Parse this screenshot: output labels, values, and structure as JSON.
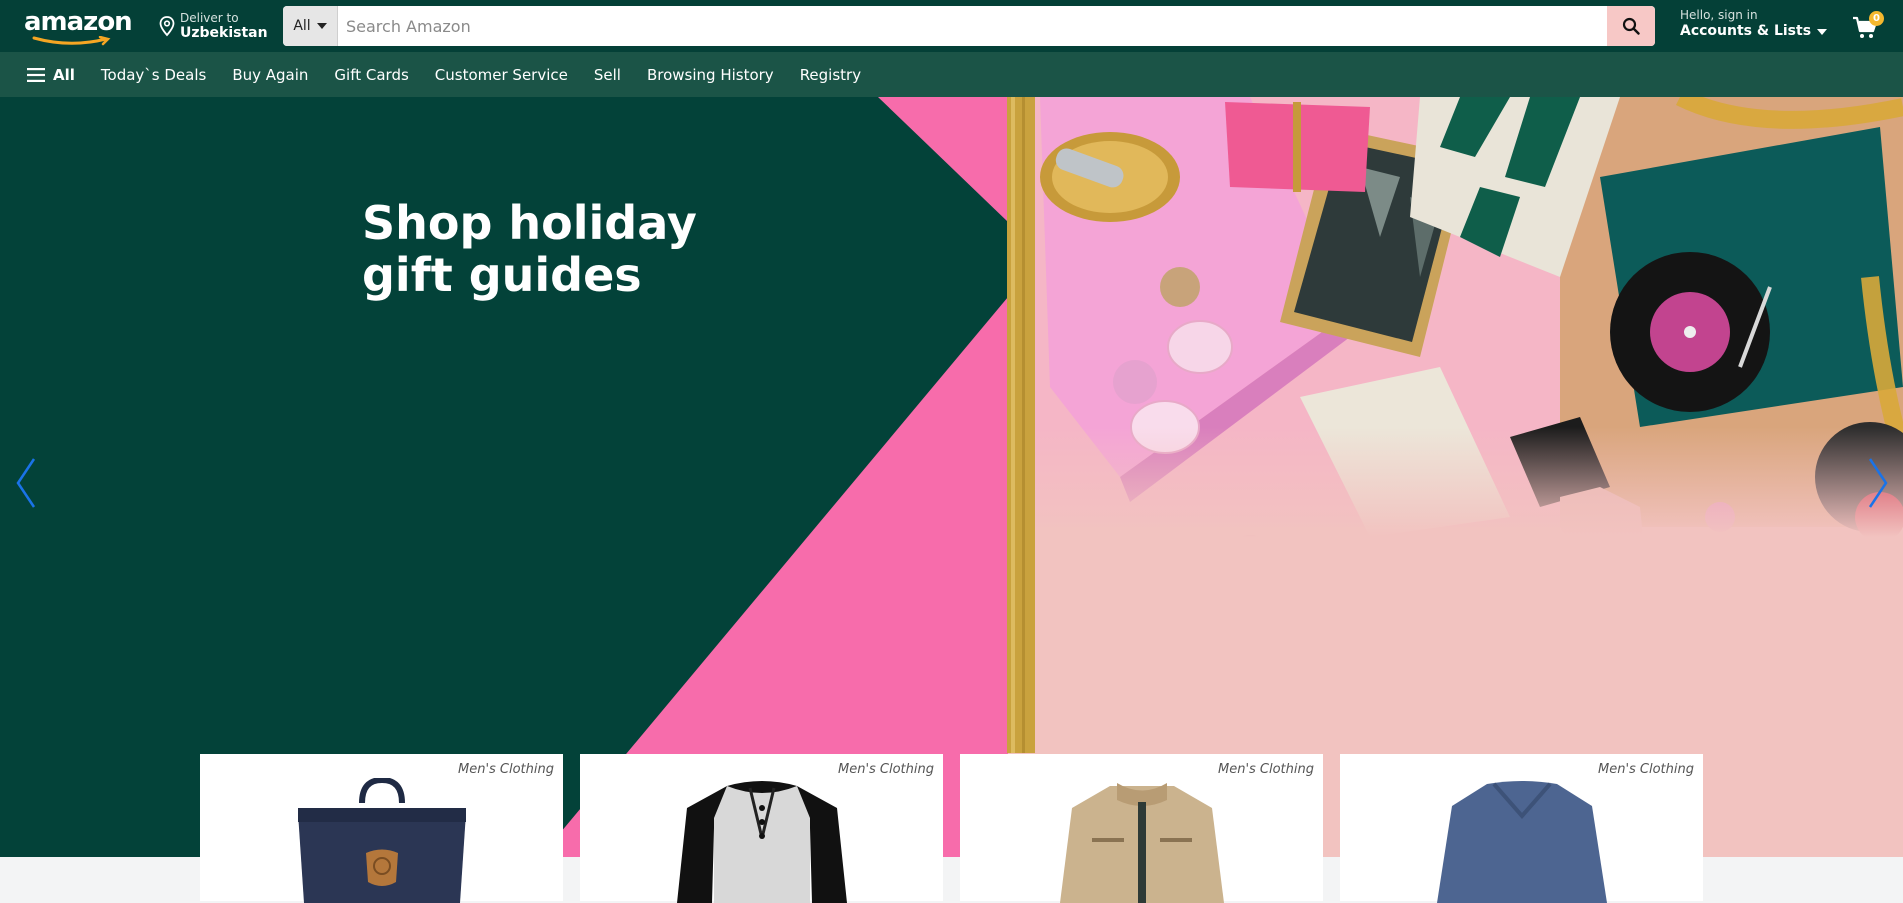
{
  "header": {
    "logo_text": "amazon",
    "deliver": {
      "line1": "Deliver to",
      "line2": "Uzbekistan"
    },
    "search": {
      "category": "All",
      "placeholder": "Search Amazon"
    },
    "account": {
      "line1": "Hello, sign in",
      "line2": "Accounts & Lists"
    },
    "cart": {
      "count": "0"
    }
  },
  "nav": {
    "all_label": "All",
    "items": [
      "Today`s Deals",
      "Buy Again",
      "Gift Cards",
      "Customer Service",
      "Sell",
      "Browsing History",
      "Registry"
    ]
  },
  "hero": {
    "title_line1": "Shop holiday",
    "title_line2": "gift guides"
  },
  "products": [
    {
      "category": "Men's Clothing",
      "item": "backpack"
    },
    {
      "category": "Men's Clothing",
      "item": "henley-shirt"
    },
    {
      "category": "Men's Clothing",
      "item": "jacket"
    },
    {
      "category": "Men's Clothing",
      "item": "sweater"
    }
  ],
  "colors": {
    "header_bg": "#044037",
    "nav_bg": "#1b5447",
    "hero_dark_green": "#034239",
    "hero_pink": "#f76cab",
    "hero_blush": "#f2c3c0",
    "search_button": "#f7c8c6",
    "carousel_arrow": "#1a73e8"
  }
}
